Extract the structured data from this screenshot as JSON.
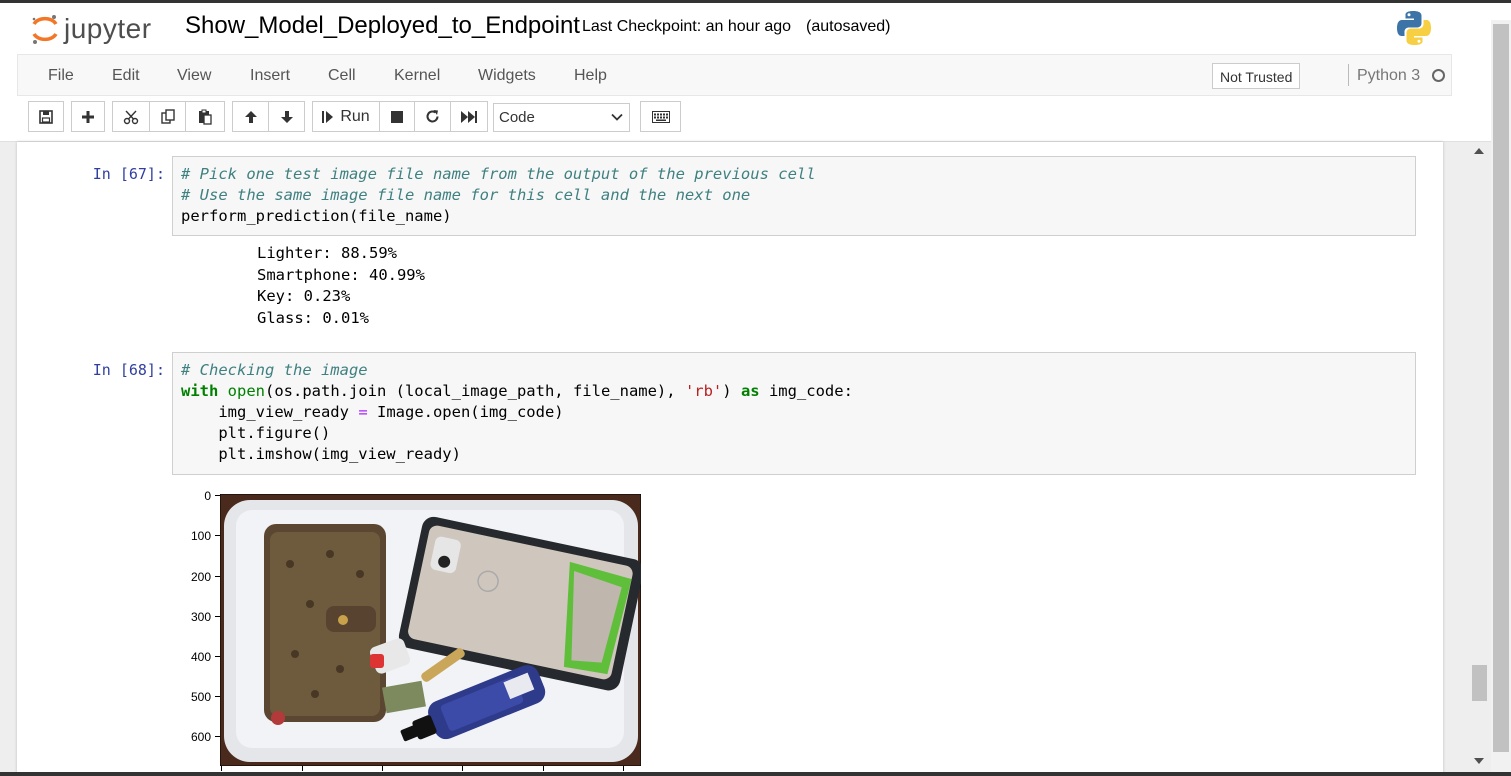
{
  "header": {
    "logo_text": "jupyter",
    "notebook_name": "Show_Model_Deployed_to_Endpoint",
    "checkpoint": "Last Checkpoint: an hour ago",
    "autosave": "(autosaved)"
  },
  "menubar": {
    "items": [
      "File",
      "Edit",
      "View",
      "Insert",
      "Cell",
      "Kernel",
      "Widgets",
      "Help"
    ],
    "trust_label": "Not Trusted",
    "kernel_name": "Python 3"
  },
  "toolbar": {
    "run_label": "Run",
    "cell_type": "Code",
    "buttons": [
      "save-icon",
      "plus-icon",
      "cut-icon",
      "copy-icon",
      "paste-icon",
      "arrow-up-icon",
      "arrow-down-icon",
      "run-icon",
      "stop-icon",
      "restart-icon",
      "fast-forward-icon",
      "keyboard-icon"
    ]
  },
  "cells": [
    {
      "prompt": "In [67]:",
      "code_lines": [
        "# Pick one test image file name from the output of the previous cell",
        "# Use the same image file name for this cell and the next one",
        "perform_prediction(file_name)"
      ],
      "output_lines": [
        "Lighter: 88.59%",
        "Smartphone: 40.99%",
        "Key: 0.23%",
        "Glass: 0.01%"
      ]
    },
    {
      "prompt": "In [68]:",
      "code_lines": [
        "# Checking the image",
        "with open(os.path.join (local_image_path, file_name), 'rb') as img_code:",
        "    img_view_ready = Image.open(img_code)",
        "    plt.figure()",
        "    plt.imshow(img_view_ready)"
      ],
      "plot": {
        "yticks": [
          "0",
          "100",
          "200",
          "300",
          "400",
          "500",
          "600"
        ],
        "image_description_icon": "photo-of-tray-with-wallet-phone-lighter-spray-icon"
      }
    }
  ],
  "colors": {
    "prompt": "#303f9f",
    "comment": "#408080",
    "keyword": "#008000",
    "string": "#ba2121",
    "operator": "#aa22ff",
    "jupyter_orange": "#f37726"
  }
}
